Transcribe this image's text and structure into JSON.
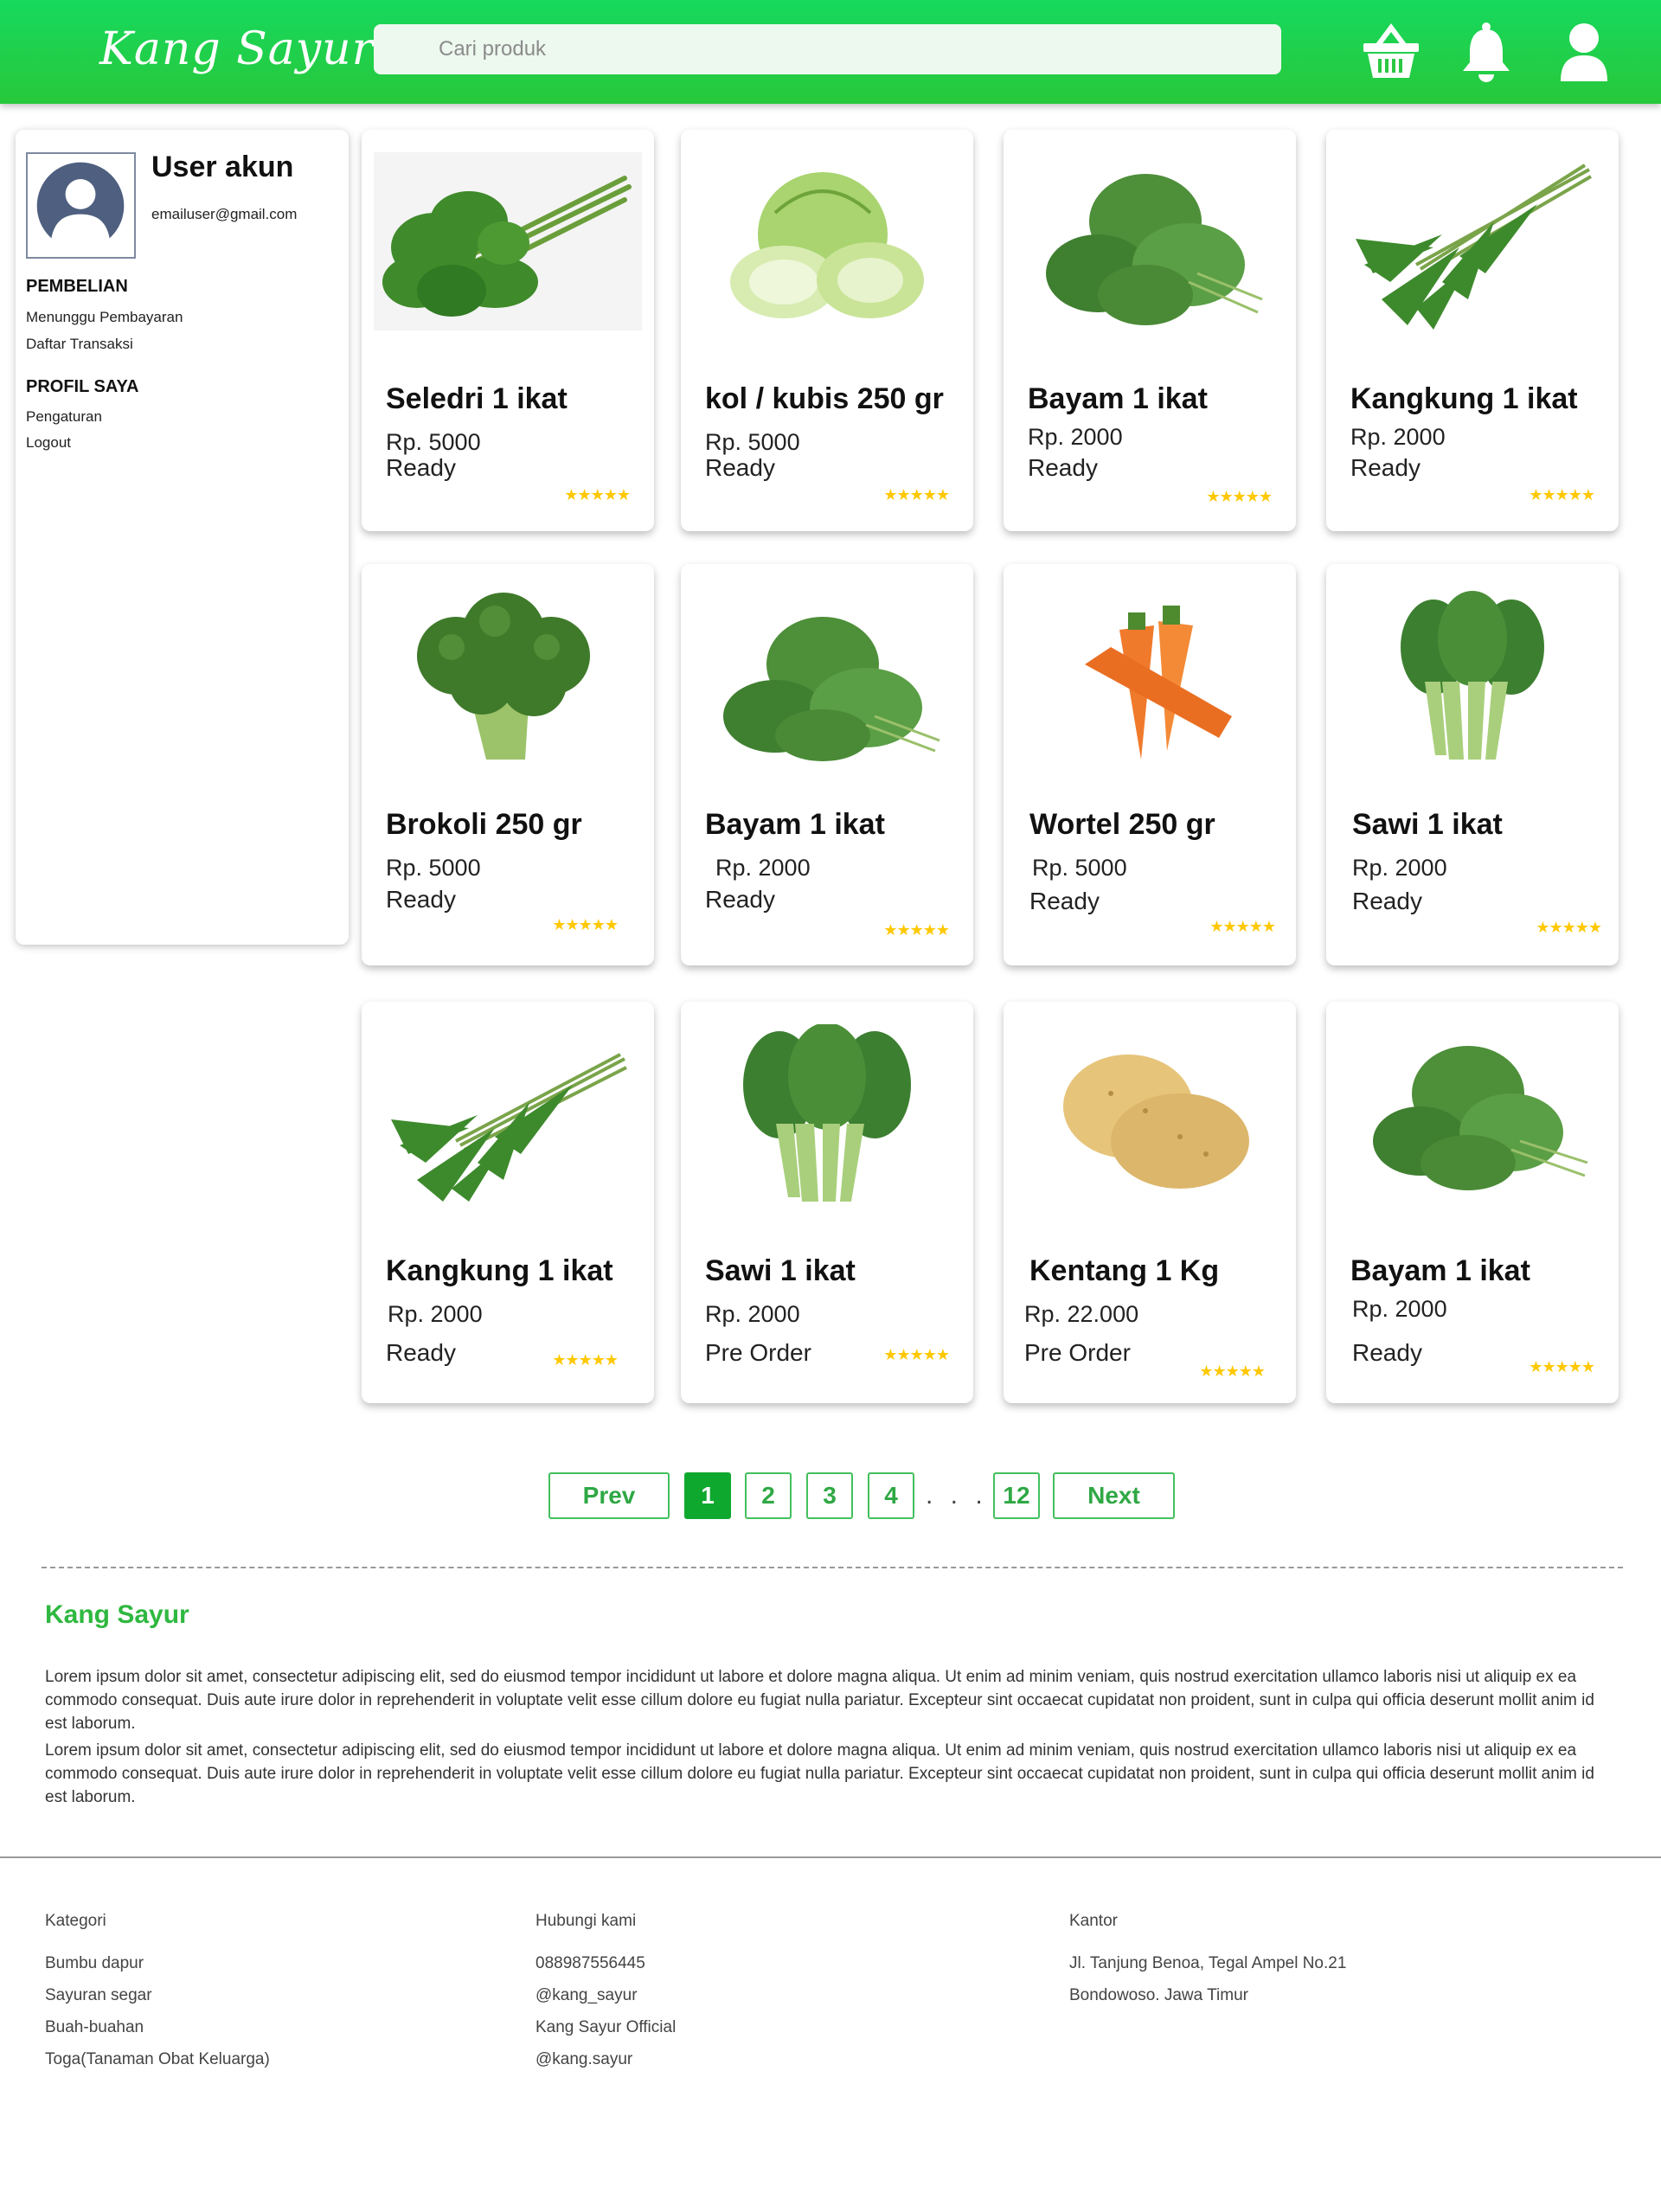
{
  "header": {
    "logo": "Kang Sayur",
    "search_placeholder": "Cari produk",
    "icons": [
      "basket-icon",
      "bell-icon",
      "user-icon"
    ]
  },
  "sidebar": {
    "user_name": "User akun",
    "user_email": "emailuser@gmail.com",
    "section1_title": "PEMBELIAN",
    "section1_items": [
      "Menunggu Pembayaran",
      "Daftar Transaksi"
    ],
    "section2_title": "PROFIL SAYA",
    "section2_items": [
      "Pengaturan",
      "Logout"
    ]
  },
  "products": [
    {
      "name": "Seledri 1 ikat",
      "price": "Rp. 5000",
      "status": "Ready",
      "rating": "★★★★★",
      "image": "celery"
    },
    {
      "name": "kol / kubis 250 gr",
      "price": "Rp. 5000",
      "status": "Ready",
      "rating": "★★★★★",
      "image": "cabbage"
    },
    {
      "name": "Bayam 1 ikat",
      "price": "Rp. 2000",
      "status": "Ready",
      "rating": "★★★★★",
      "image": "spinach"
    },
    {
      "name": "Kangkung 1 ikat",
      "price": "Rp. 2000",
      "status": "Ready",
      "rating": "★★★★★",
      "image": "water-spinach"
    },
    {
      "name": "Brokoli 250 gr",
      "price": "Rp. 5000",
      "status": "Ready",
      "rating": "★★★★★",
      "image": "broccoli"
    },
    {
      "name": "Bayam 1 ikat",
      "price": "Rp. 2000",
      "status": "Ready",
      "rating": "★★★★★",
      "image": "spinach"
    },
    {
      "name": "Wortel 250 gr",
      "price": "Rp. 5000",
      "status": "Ready",
      "rating": "★★★★★",
      "image": "carrot"
    },
    {
      "name": "Sawi 1 ikat",
      "price": "Rp. 2000",
      "status": "Ready",
      "rating": "★★★★★",
      "image": "mustard-greens"
    },
    {
      "name": "Kangkung 1 ikat",
      "price": "Rp. 2000",
      "status": "Ready",
      "rating": "★★★★★",
      "image": "water-spinach"
    },
    {
      "name": "Sawi 1 ikat",
      "price": "Rp. 2000",
      "status": "Pre Order",
      "rating": "★★★★★",
      "image": "mustard-greens"
    },
    {
      "name": "Kentang 1 Kg",
      "price": "Rp. 22.000",
      "status": "Pre Order",
      "rating": "★★★★★",
      "image": "potato"
    },
    {
      "name": "Bayam 1 ikat",
      "price": "Rp. 2000",
      "status": "Ready",
      "rating": "★★★★★",
      "image": "spinach"
    }
  ],
  "pagination": {
    "prev": "Prev",
    "pages": [
      "1",
      "2",
      "3",
      "4"
    ],
    "ellipsis": ". . .",
    "last": "12",
    "next": "Next",
    "active": "1"
  },
  "about": {
    "title": "Kang Sayur",
    "p1": "Lorem ipsum dolor sit amet, consectetur adipiscing elit, sed do eiusmod tempor incididunt ut labore et dolore magna aliqua. Ut enim ad minim veniam, quis nostrud exercitation ullamco laboris nisi ut aliquip ex ea commodo consequat. Duis aute irure dolor in reprehenderit in voluptate velit esse cillum dolore eu fugiat nulla pariatur. Excepteur sint occaecat cupidatat non proident, sunt in culpa qui officia deserunt mollit anim id est laborum.",
    "p2": "Lorem ipsum dolor sit amet, consectetur adipiscing elit, sed do eiusmod tempor incididunt ut labore et dolore magna aliqua. Ut enim ad minim veniam, quis nostrud exercitation ullamco laboris nisi ut aliquip ex ea commodo consequat. Duis aute irure dolor in reprehenderit in voluptate velit esse cillum dolore eu fugiat nulla pariatur. Excepteur sint occaecat cupidatat non proident, sunt in culpa qui officia deserunt mollit anim id est laborum."
  },
  "footer": {
    "kategori": {
      "title": "Kategori",
      "items": [
        "Bumbu dapur",
        "Sayuran segar",
        "Buah-buahan",
        "Toga(Tanaman Obat Keluarga)"
      ]
    },
    "hubungi": {
      "title": "Hubungi kami",
      "items": [
        "088987556445",
        "@kang_sayur",
        "Kang Sayur Official",
        "@kang.sayur"
      ]
    },
    "kantor": {
      "title": "Kantor",
      "items": [
        "Jl. Tanjung Benoa, Tegal Ampel No.21",
        "Bondowoso. Jawa Timur"
      ]
    }
  },
  "colors": {
    "brand_green": "#1fd14f",
    "accent_green": "#0fa82e",
    "star": "#ffc800"
  }
}
